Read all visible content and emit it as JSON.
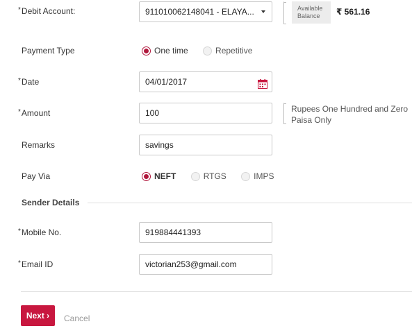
{
  "form": {
    "debit_account": {
      "required_mark": "*",
      "label": "Debit Account:",
      "value": "911010062148041 - ELAYA...",
      "balance_label": "Available Balance",
      "balance_value": "₹ 561.16"
    },
    "payment_type": {
      "label": "Payment Type",
      "options": [
        "One time",
        "Repetitive"
      ],
      "selected": "One time"
    },
    "date": {
      "required_mark": "*",
      "label": "Date",
      "value": "04/01/2017",
      "icon": "calendar-icon"
    },
    "amount": {
      "required_mark": "*",
      "label": "Amount",
      "value": "100",
      "in_words": "Rupees One Hundred and Zero Paisa Only"
    },
    "remarks": {
      "label": "Remarks",
      "value": "savings"
    },
    "pay_via": {
      "label": "Pay Via",
      "options": [
        "NEFT",
        "RTGS",
        "IMPS"
      ],
      "selected": "NEFT"
    },
    "sender_details": {
      "heading": "Sender Details"
    },
    "mobile": {
      "required_mark": "*",
      "label": "Mobile No.",
      "value": "919884441393"
    },
    "email": {
      "required_mark": "*",
      "label": "Email ID",
      "value": "victorian253@gmail.com"
    }
  },
  "actions": {
    "next_label": "Next ›",
    "cancel_label": "Cancel"
  },
  "colors": {
    "accent": "#c8173f",
    "radio_checked": "#b0173c",
    "border": "#c9c9c9"
  }
}
